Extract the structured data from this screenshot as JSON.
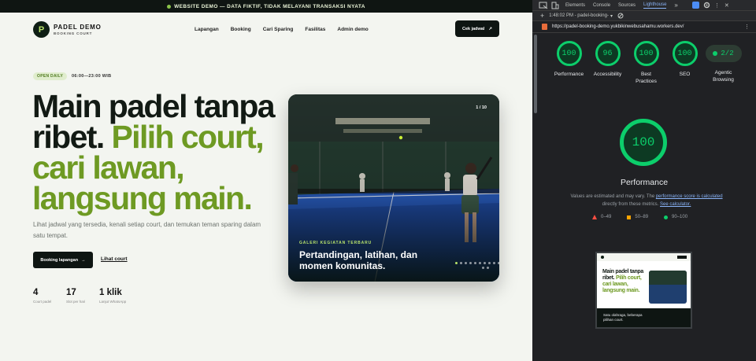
{
  "banner": {
    "text": "WEBSITE DEMO — DATA FIKTIF, TIDAK MELAYANI TRANSAKSI NYATA"
  },
  "brand": {
    "logo_letter": "P",
    "name": "PADEL DEMO",
    "subtitle": "BOOKING COURT"
  },
  "nav": {
    "items": [
      "Lapangan",
      "Booking",
      "Cari Sparing",
      "Fasilitas",
      "Admin demo"
    ]
  },
  "header_cta": {
    "label": "Cek jadwal",
    "arrow": "↗"
  },
  "hero": {
    "badge": "OPEN DAILY",
    "hours": "06:00—23:00 WIB",
    "title_dark_1": "Main padel tanpa ribet.",
    "title_green": "Pilih court, cari lawan, langsung main.",
    "lead": "Lihat jadwal yang tersedia, kenali setiap court, dan temukan teman sparing dalam satu tempat.",
    "primary_label": "Booking lapangan",
    "primary_arrow": "→",
    "secondary_label": "Lihat court"
  },
  "stats": [
    {
      "value": "4",
      "label": "Court padel"
    },
    {
      "value": "17",
      "label": "Slot per hari"
    },
    {
      "value": "1 klik",
      "label": "Lanjut WhatsApp"
    }
  ],
  "gallery": {
    "counter": "1 / 10",
    "kicker": "GALERI KEGIATAN TERBARU",
    "title": "Pertandingan, latihan, dan momen komunitas."
  },
  "devtools": {
    "tabs": [
      "Elements",
      "Console",
      "Sources",
      "Lighthouse"
    ],
    "active_tab": "Lighthouse",
    "report_label": "1:48:02 PM - padel-booking-",
    "url": "https://padel-booking-demo.yukbikinwebusahamu.workers.dev/",
    "gauges": [
      {
        "score": "100",
        "label": "Performance"
      },
      {
        "score": "96",
        "label": "Accessibility"
      },
      {
        "score": "100",
        "label": "Best Practices"
      },
      {
        "score": "100",
        "label": "SEO"
      }
    ],
    "agentic": {
      "score": "2/2",
      "label": "Agentic Browsing"
    },
    "big_score": "100",
    "big_title": "Performance",
    "note_prefix": "Values are estimated and may vary. The",
    "note_link1": "performance score is calculated",
    "note_mid": "directly from these metrics.",
    "note_link2": "See calculator.",
    "legend": [
      {
        "range": "0–49",
        "color": "#ff4e42"
      },
      {
        "range": "50–89",
        "color": "#ffa400"
      },
      {
        "range": "90–100",
        "color": "#0cce6b"
      }
    ],
    "thumbnail": {
      "title_dark": "Main padel tanpa ribet.",
      "title_green": "Pilih court, cari lawan, langsung main.",
      "lower_text": "Satu olahraga, beberapa pilihan court."
    }
  },
  "colors": {
    "accent_green": "#6e9a23",
    "dark": "#0e1512",
    "lighthouse_pass": "#0cce6b"
  }
}
